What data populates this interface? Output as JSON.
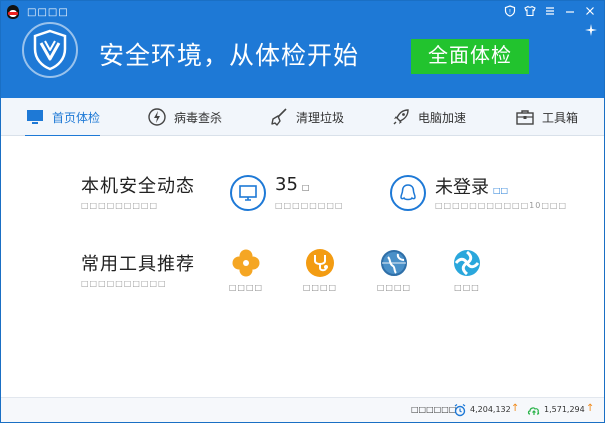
{
  "window": {
    "title": "□□□□"
  },
  "header": {
    "slogan": "安全环境，从体检开始",
    "scan_button": "全面体检"
  },
  "nav": {
    "items": [
      {
        "label": "首页体检",
        "icon": "monitor-icon",
        "active": true
      },
      {
        "label": "病毒查杀",
        "icon": "lightning-icon",
        "active": false
      },
      {
        "label": "清理垃圾",
        "icon": "broom-icon",
        "active": false
      },
      {
        "label": "电脑加速",
        "icon": "rocket-icon",
        "active": false
      },
      {
        "label": "工具箱",
        "icon": "toolbox-icon",
        "active": false
      }
    ]
  },
  "main": {
    "security": {
      "title": "本机安全动态",
      "subtitle": "□□□□□□□□□",
      "days_value": "35",
      "days_unit": "□",
      "days_sub": "□□□□□□□□",
      "login_title": "未登录",
      "login_link": "□□",
      "login_sub": "□□□□□□□□□□□10□□□"
    },
    "tools": {
      "title": "常用工具推荐",
      "subtitle": "□□□□□□□□□□",
      "items": [
        {
          "label": "□□□□",
          "icon": "clover-icon",
          "color": "#f5a623"
        },
        {
          "label": "□□□□",
          "icon": "stethoscope-icon",
          "color": "#f39c12"
        },
        {
          "label": "□□□□",
          "icon": "globe-icon",
          "color": "#2f7fc1"
        },
        {
          "label": "□□□",
          "icon": "swirl-icon",
          "color": "#2aa7dc"
        }
      ]
    }
  },
  "footer": {
    "label": "□□□□□□",
    "count1": "4,204,132",
    "count2": "1,571,294"
  },
  "colors": {
    "primary": "#1e79d6",
    "scan_green": "#22c32e",
    "accent_orange": "#f08a1a"
  }
}
